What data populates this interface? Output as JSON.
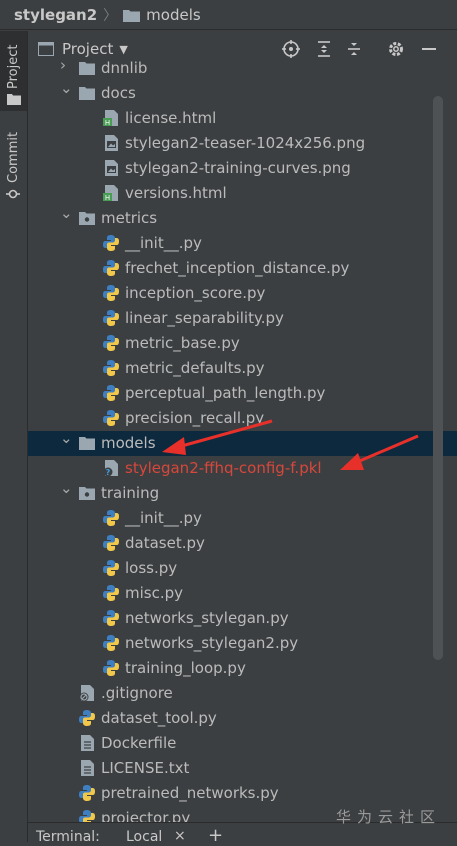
{
  "breadcrumb": {
    "root": "stylegan2",
    "folder": "models"
  },
  "toolstrip": {
    "project_tab": "Project",
    "commit_tab": "Commit"
  },
  "panel": {
    "title": "Project"
  },
  "tree": [
    {
      "label": "dnnlib",
      "type": "folder",
      "level": 1,
      "expanded": false
    },
    {
      "label": "docs",
      "type": "folder",
      "level": 1,
      "expanded": true
    },
    {
      "label": "license.html",
      "type": "html",
      "level": 2
    },
    {
      "label": "stylegan2-teaser-1024x256.png",
      "type": "image",
      "level": 2
    },
    {
      "label": "stylegan2-training-curves.png",
      "type": "image",
      "level": 2
    },
    {
      "label": "versions.html",
      "type": "html",
      "level": 2
    },
    {
      "label": "metrics",
      "type": "package",
      "level": 1,
      "expanded": true
    },
    {
      "label": "__init__.py",
      "type": "python",
      "level": 2
    },
    {
      "label": "frechet_inception_distance.py",
      "type": "python",
      "level": 2
    },
    {
      "label": "inception_score.py",
      "type": "python",
      "level": 2
    },
    {
      "label": "linear_separability.py",
      "type": "python",
      "level": 2
    },
    {
      "label": "metric_base.py",
      "type": "python",
      "level": 2
    },
    {
      "label": "metric_defaults.py",
      "type": "python",
      "level": 2
    },
    {
      "label": "perceptual_path_length.py",
      "type": "python",
      "level": 2
    },
    {
      "label": "precision_recall.py",
      "type": "python",
      "level": 2
    },
    {
      "label": "models",
      "type": "folder",
      "level": 1,
      "expanded": true,
      "selected": true
    },
    {
      "label": "stylegan2-ffhq-config-f.pkl",
      "type": "unknown",
      "level": 2,
      "highlight": true
    },
    {
      "label": "training",
      "type": "package",
      "level": 1,
      "expanded": true
    },
    {
      "label": "__init__.py",
      "type": "python",
      "level": 2
    },
    {
      "label": "dataset.py",
      "type": "python",
      "level": 2
    },
    {
      "label": "loss.py",
      "type": "python",
      "level": 2
    },
    {
      "label": "misc.py",
      "type": "python",
      "level": 2
    },
    {
      "label": "networks_stylegan.py",
      "type": "python",
      "level": 2
    },
    {
      "label": "networks_stylegan2.py",
      "type": "python",
      "level": 2
    },
    {
      "label": "training_loop.py",
      "type": "python",
      "level": 2
    },
    {
      "label": ".gitignore",
      "type": "ignore",
      "level": 1
    },
    {
      "label": "dataset_tool.py",
      "type": "python",
      "level": 1
    },
    {
      "label": "Dockerfile",
      "type": "text",
      "level": 1
    },
    {
      "label": "LICENSE.txt",
      "type": "text",
      "level": 1
    },
    {
      "label": "pretrained_networks.py",
      "type": "python",
      "level": 1
    },
    {
      "label": "projector.py",
      "type": "python",
      "level": 1
    }
  ],
  "bottom": {
    "terminal": "Terminal:",
    "local": "Local",
    "close": "×",
    "add": "+"
  },
  "watermark": "华为云社区",
  "colors": {
    "selected_row": "#0d293e",
    "annotation_arrow": "#e8302a",
    "highlight_text": "#d8473b"
  }
}
